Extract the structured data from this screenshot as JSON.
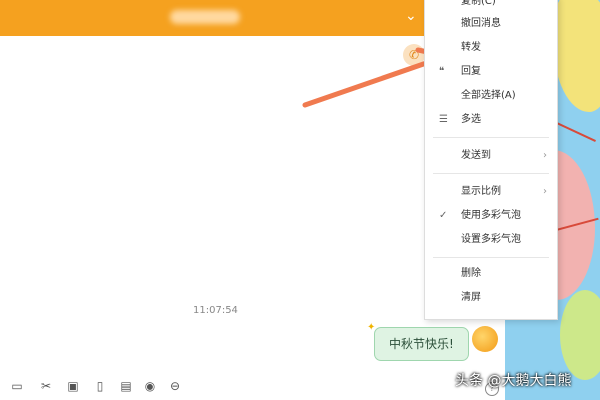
{
  "header": {
    "chevron": "⌄"
  },
  "chat": {
    "timestamp": "11:07:54",
    "message": "中秋节快乐!"
  },
  "context_menu": {
    "items": [
      {
        "label": "复制(C)"
      },
      {
        "label": "撤回消息"
      },
      {
        "label": "转发"
      },
      {
        "label": "回复"
      },
      {
        "label": "全部选择(A)"
      },
      {
        "label": "多选"
      },
      {
        "label": "发送到",
        "submenu": "›"
      },
      {
        "label": "显示比例",
        "submenu": "›"
      },
      {
        "label": "使用多彩气泡",
        "checked": true,
        "check": "✓"
      },
      {
        "label": "设置多彩气泡"
      },
      {
        "label": "删除"
      },
      {
        "label": "清屏"
      }
    ]
  },
  "toolbar": {
    "icons": [
      "folder-icon",
      "screenshot-icon",
      "image-icon",
      "phone-icon",
      "calendar-icon",
      "music-icon",
      "more-icon"
    ]
  },
  "watermark": "头条 @大鹅大白熊",
  "colors": {
    "titlebar": "#f5a11f",
    "bubble": "#dff3e3",
    "arrow": "#f07a4f"
  }
}
